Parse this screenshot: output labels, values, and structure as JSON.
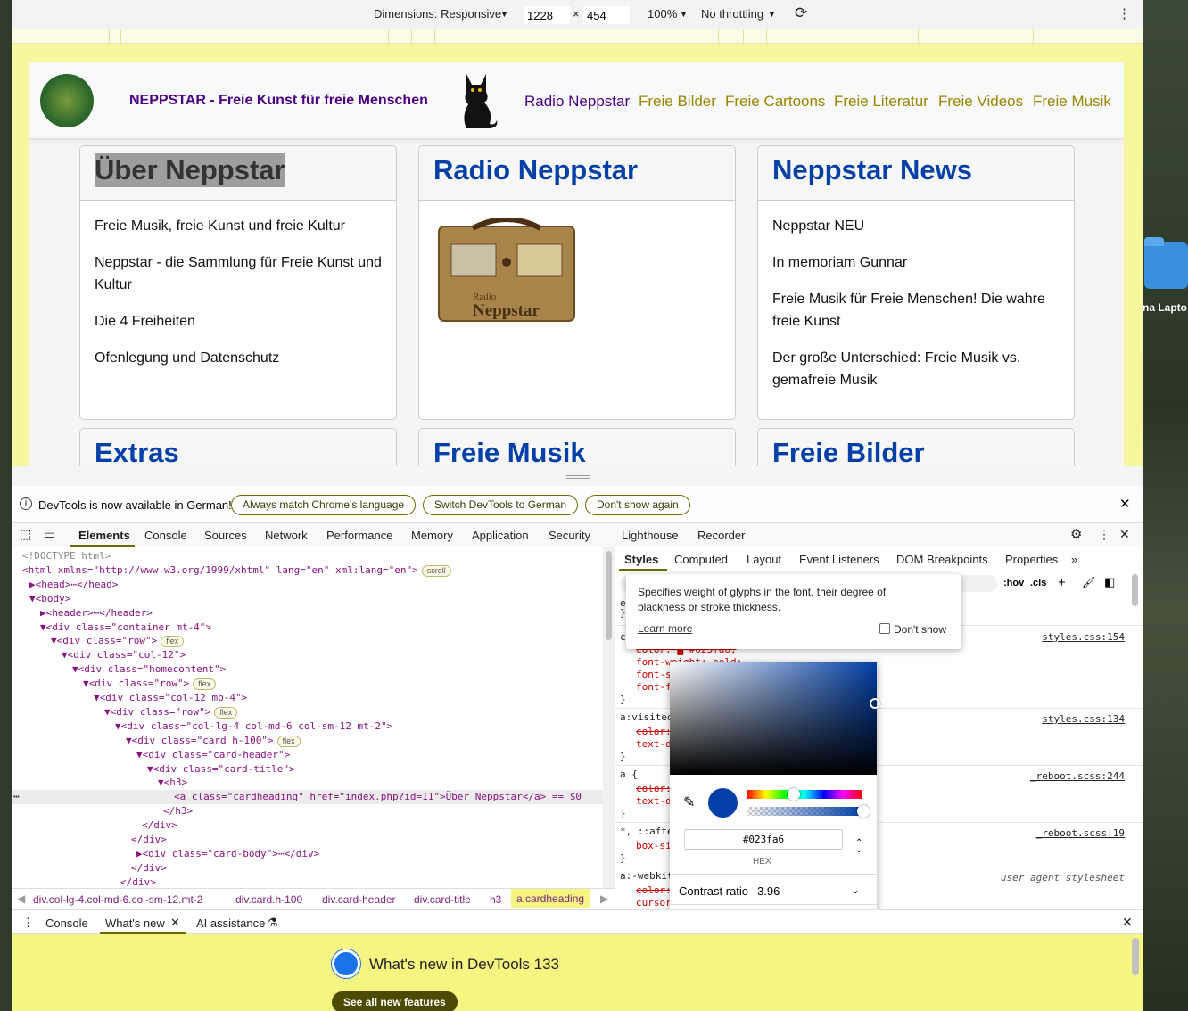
{
  "device_toolbar": {
    "dimensions_label": "Dimensions: Responsive",
    "width_value": "1228",
    "height_value": "454",
    "times": "×",
    "zoom": "100%",
    "throttling": "No throttling"
  },
  "site": {
    "title": "NEPPSTAR - Freie Kunst für freie Menschen",
    "nav": [
      {
        "label": "Radio Neppstar",
        "color": "#4b0082"
      },
      {
        "label": "Freie Bilder",
        "color": "#9a8600"
      },
      {
        "label": "Freie Cartoons",
        "color": "#9a8600"
      },
      {
        "label": "Freie Literatur",
        "color": "#9a8600"
      },
      {
        "label": "Freie Videos",
        "color": "#9a8600"
      },
      {
        "label": "Freie Musik",
        "color": "#9a8600"
      }
    ],
    "cards": [
      {
        "heading": "Über Neppstar",
        "items": [
          "Freie Musik, freie Kunst und freie Kultur",
          "Neppstar - die Sammlung für Freie Kunst und Kultur",
          "Die 4 Freiheiten",
          "Ofenlegung und Datenschutz"
        ]
      },
      {
        "heading": "Radio Neppstar",
        "image_text_1": "Radio",
        "image_text_2": "Neppstar"
      },
      {
        "heading": "Neppstar News",
        "items": [
          "Neppstar NEU",
          "In memoriam Gunnar",
          "Freie Musik für Freie Menschen! Die wahre freie Kunst",
          "Der große Unterschied: Freie Musik vs. gemafreie Musik"
        ]
      },
      {
        "heading": "Extras"
      },
      {
        "heading": "Freie Musik"
      },
      {
        "heading": "Freie Bilder"
      }
    ]
  },
  "infobar": {
    "message": "DevTools is now available in German!",
    "btn1": "Always match Chrome's language",
    "btn2": "Switch DevTools to German",
    "btn3": "Don't show again"
  },
  "devtools_tabs": [
    "Elements",
    "Console",
    "Sources",
    "Network",
    "Performance",
    "Memory",
    "Application",
    "Security",
    "Lighthouse",
    "Recorder"
  ],
  "elements": {
    "lines": [
      {
        "t": "<!DOCTYPE html>"
      },
      {
        "t": "<html xmlns=\"http://www.w3.org/1999/xhtml\" lang=\"en\" xml:lang=\"en\">",
        "badge": "scroll"
      },
      {
        "t": "▶<head>⋯</head>"
      },
      {
        "t": "▼<body>"
      },
      {
        "t": "▶<header>⋯</header>"
      },
      {
        "t": "▼<div class=\"container mt-4\">"
      },
      {
        "t": "▼<div class=\"row\">",
        "badge": "flex"
      },
      {
        "t": "▼<div class=\"col-12\">"
      },
      {
        "t": "▼<div class=\"homecontent\">"
      },
      {
        "t": "▼<div class=\"row\">",
        "badge": "flex"
      },
      {
        "t": "▼<div class=\"col-12 mb-4\">"
      },
      {
        "t": "▼<div class=\"row\">",
        "badge": "flex"
      },
      {
        "t": "▼<div class=\"col-lg-4 col-md-6 col-sm-12 mt-2\">"
      },
      {
        "t": "▼<div class=\"card h-100\">",
        "badge": "flex"
      },
      {
        "t": "▼<div class=\"card-header\">"
      },
      {
        "t": "▼<div class=\"card-title\">"
      },
      {
        "t": "▼<h3>"
      },
      {
        "t": "<a class=\"cardheading\" href=\"index.php?id=11\">Über Neppstar</a> == $0"
      },
      {
        "t": "</h3>"
      },
      {
        "t": "</div>"
      },
      {
        "t": "</div>"
      },
      {
        "t": "▶<div class=\"card-body\">⋯</div>"
      },
      {
        "t": "</div>"
      },
      {
        "t": "</div>"
      }
    ],
    "dots": "⋯"
  },
  "breadcrumb": [
    "div.col-lg-4.col-md-6.col-sm-12.mt-2",
    "div.card.h-100",
    "div.card-header",
    "div.card-title",
    "h3",
    "a.cardheading"
  ],
  "styles_tabs": [
    "Styles",
    "Computed",
    "Layout",
    "Event Listeners",
    "DOM Breakpoints",
    "Properties"
  ],
  "styles": {
    "filter_tools": [
      ":hov",
      ".cls"
    ],
    "rules": [
      {
        "selector": "e",
        "source": ""
      },
      {
        "selector": "c",
        "source": "styles.css:154",
        "props": [
          "color: ▇ #023fa6;",
          "font-weight: bold;",
          "font-s",
          "font-f"
        ]
      },
      {
        "selector": "a:visited",
        "source": "styles.css:134",
        "props": [
          "color:",
          "text-d"
        ]
      },
      {
        "selector": "a {",
        "source": "_reboot.scss:244",
        "props": [
          "color:",
          "text-d"
        ]
      },
      {
        "selector": "*, ::afte",
        "source": "_reboot.scss:19",
        "props": [
          "box-si"
        ]
      },
      {
        "selector": "a:-webkit",
        "source": "user agent stylesheet",
        "props": [
          "color:",
          "cursor"
        ]
      }
    ]
  },
  "tooltip": {
    "text": "Specifies weight of glyphs in the font, their degree of blackness or stroke thickness.",
    "learn_more": "Learn more",
    "dont_show": "Don't show"
  },
  "color_picker": {
    "hex_value": "#023fa6",
    "format_label": "HEX",
    "contrast_label": "Contrast ratio",
    "contrast_value": "3.96",
    "current_color": "#023fa6",
    "swatches": [
      "#d32f2f",
      "#023fa6",
      "#1a73e8",
      "#8ab4f8",
      "#202124",
      "#3c4043",
      "#3c4043",
      "#5f6368",
      "#12b5cb",
      "#0b5345",
      "#188038",
      "#1e4620",
      "#9a8600",
      "#d6c060",
      "#f9ab00",
      "#fff8e1",
      "#fffbe6",
      "#e8eaed",
      "#dadce0",
      "#bdc1c6",
      "#202124",
      "#000000",
      "#cccccc",
      "#cccccc"
    ]
  },
  "drawer": {
    "tabs": [
      "Console",
      "What's new",
      "AI assistance"
    ],
    "whats_new_title": "What's new in DevTools 133",
    "see_all": "See all new features"
  },
  "desktop": {
    "folder_label": "na Lapto"
  }
}
